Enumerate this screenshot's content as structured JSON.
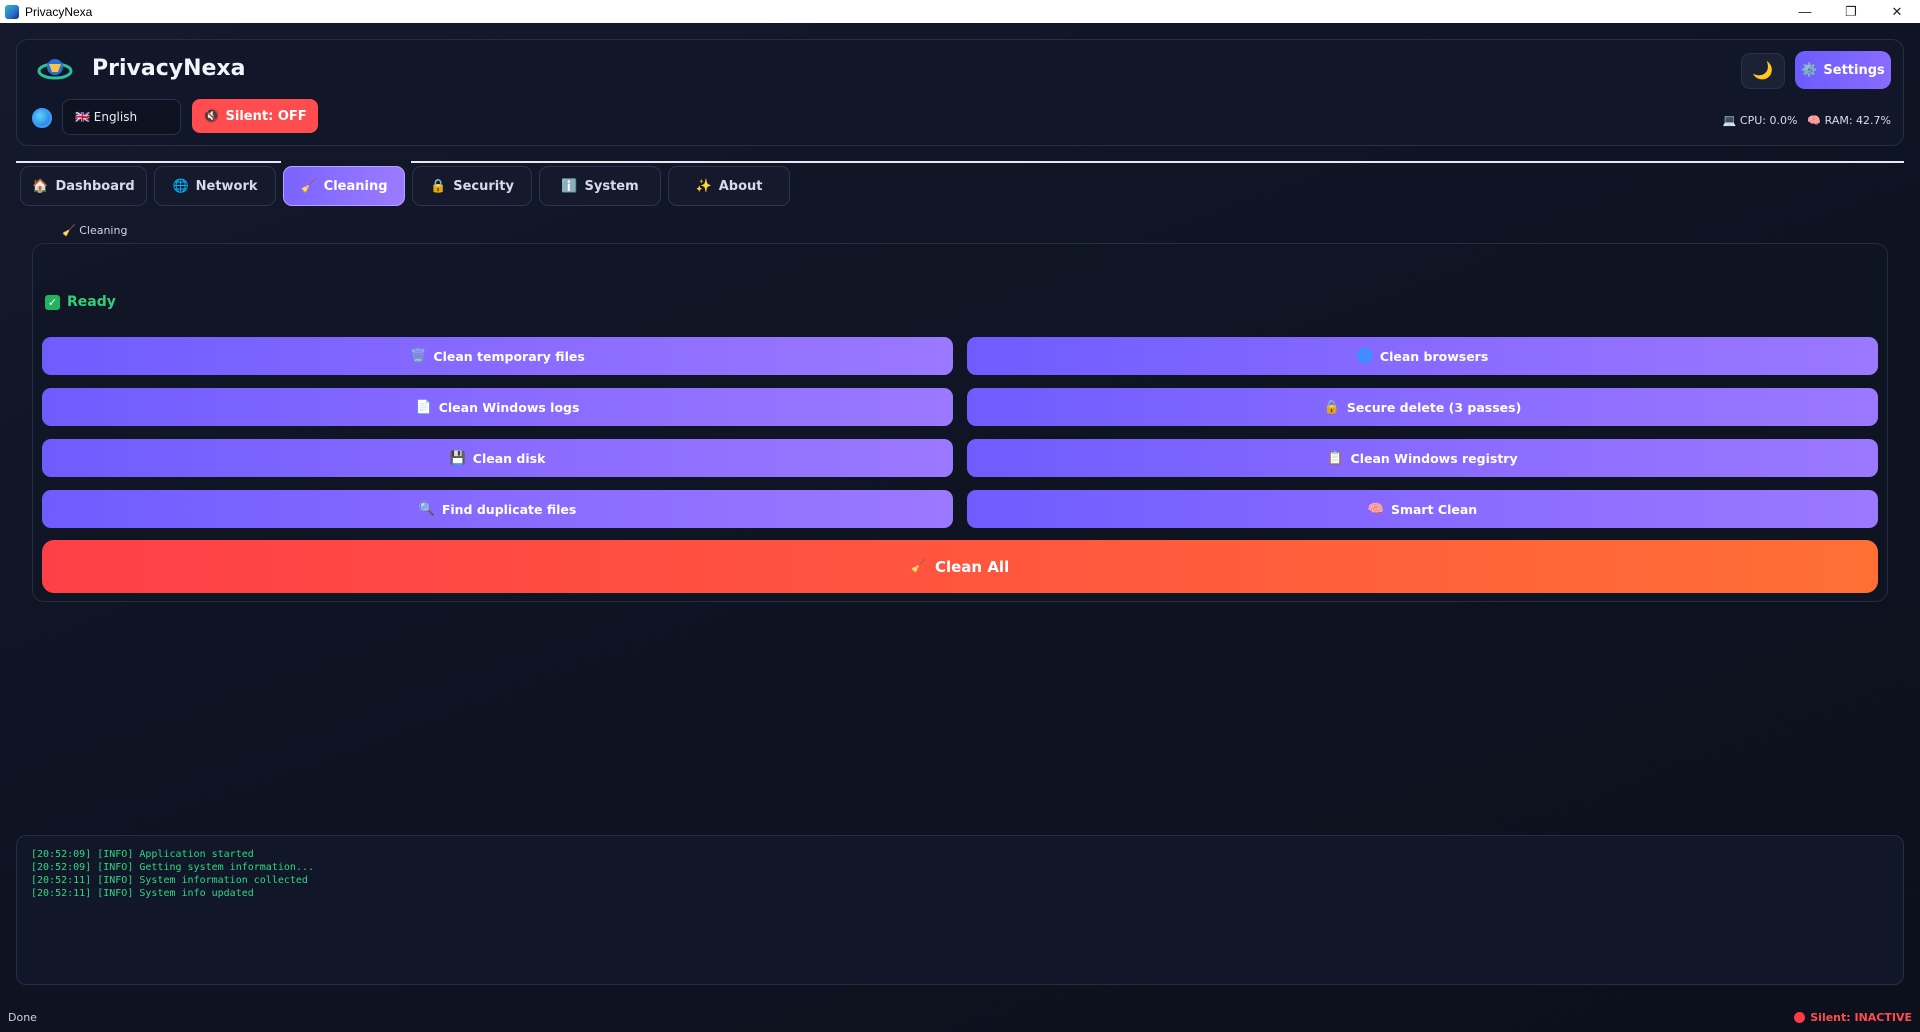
{
  "window": {
    "title": "PrivacyNexa",
    "controls": [
      "—",
      "❐",
      "✕"
    ]
  },
  "header": {
    "app_name": "PrivacyNexa",
    "language": "🇬🇧 English",
    "silent_button": "Silent: OFF",
    "silent_icon": "🔇",
    "theme_icon": "🌙",
    "settings_label": "Settings",
    "settings_icon": "⚙️",
    "cpu": "CPU: 0.0%",
    "cpu_icon": "💻",
    "ram": "RAM: 42.7%",
    "ram_icon": "🧠"
  },
  "tabs": [
    {
      "icon": "🏠",
      "label": "Dashboard"
    },
    {
      "icon": "🌐",
      "label": "Network"
    },
    {
      "icon": "🧹",
      "label": "Cleaning"
    },
    {
      "icon": "🔒",
      "label": "Security"
    },
    {
      "icon": "ℹ️",
      "label": "System"
    },
    {
      "icon": "✨",
      "label": "About"
    }
  ],
  "active_tab": "Cleaning",
  "section": {
    "icon": "🧹",
    "title": "Cleaning"
  },
  "status": {
    "icon": "✓",
    "text": "Ready"
  },
  "actions": [
    {
      "icon": "🗑️",
      "label": "Clean temporary files"
    },
    {
      "icon": "🌐",
      "label": "Clean browsers"
    },
    {
      "icon": "📄",
      "label": "Clean Windows logs"
    },
    {
      "icon": "🔒",
      "label": "Secure delete (3 passes)"
    },
    {
      "icon": "💾",
      "label": "Clean disk"
    },
    {
      "icon": "📋",
      "label": "Clean Windows registry"
    },
    {
      "icon": "🔍",
      "label": "Find duplicate files"
    },
    {
      "icon": "🧠",
      "label": "Smart Clean"
    }
  ],
  "clean_all": {
    "icon": "🧹",
    "label": "Clean All"
  },
  "log": [
    "[20:52:09] [INFO] Application started",
    "[20:52:09] [INFO] Getting system information...",
    "[20:52:11] [INFO] System information collected",
    "[20:52:11] [INFO] System info updated"
  ],
  "statusbar": {
    "left": "Done",
    "right": "Silent: INACTIVE"
  },
  "colors": {
    "accent": "#7a63ff",
    "danger": "#ff4d4f",
    "success": "#2fd07a",
    "background": "#0e1220"
  }
}
